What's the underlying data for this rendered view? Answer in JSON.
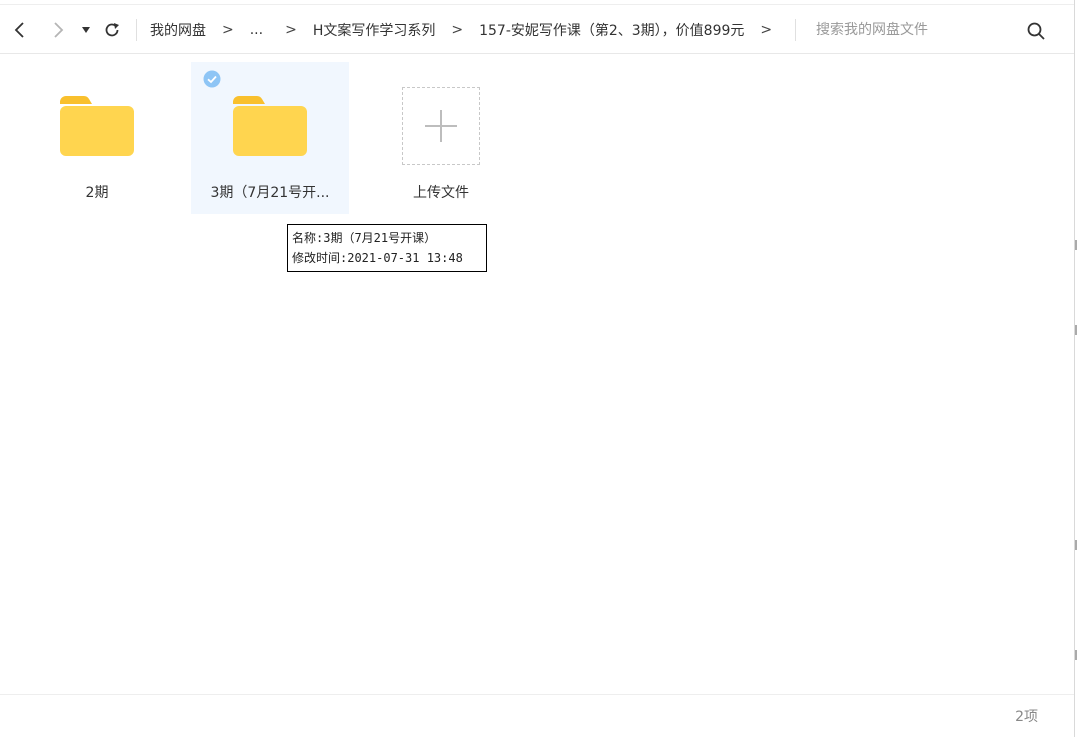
{
  "toolbar": {
    "back_icon": "chevron-left-icon",
    "forward_icon": "chevron-right-icon",
    "history_icon": "caret-down-icon",
    "refresh_icon": "refresh-icon",
    "breadcrumb": [
      "我的网盘",
      "...",
      "H文案写作学习系列",
      "157-安妮写作课（第2、3期），价值899元"
    ],
    "breadcrumb_separator": ">",
    "search": {
      "placeholder": "搜索我的网盘文件",
      "value": ""
    },
    "search_icon": "search-icon"
  },
  "files": [
    {
      "name": "2期",
      "type": "folder",
      "selected": false
    },
    {
      "name": "3期（7月21号开...",
      "type": "folder",
      "selected": true
    }
  ],
  "upload": {
    "label": "上传文件",
    "icon": "plus-icon"
  },
  "tooltip": {
    "line1": "名称:3期（7月21号开课）",
    "line2": "修改时间:2021-07-31 13:48"
  },
  "footer": {
    "item_count": "2项"
  },
  "colors": {
    "folder": "#FFD54F",
    "folder_tab": "#F9C02D",
    "selected_bg": "#F1F7FE",
    "check": "#8EC5F5",
    "text": "#333333",
    "muted": "#999999"
  }
}
